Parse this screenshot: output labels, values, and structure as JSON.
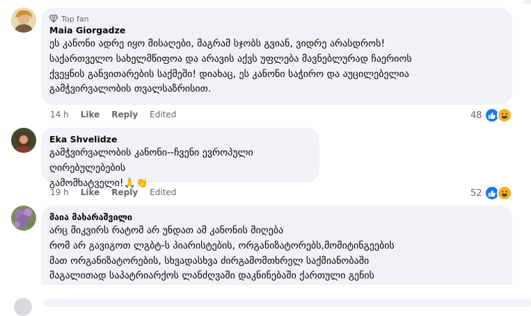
{
  "comments": [
    {
      "badge": "Top fan",
      "author": "Maia Giorgadze",
      "text": "ეს კანონი ადრე იყო მისაღები, მაგრამ სჯობს გვიან, ვიდრე არასდროს!\nსაქართველო სახელმწიფოა და არავის აქვს უფლება მავნებლურად ჩაერიოს\nქვეყნის განვითარების საქმეში! დიახაც, ეს კანონი საჭირო და აუცილებელია\nგამჭვირვალობის თვალსაზრისით.",
      "time": "14 h",
      "like": "Like",
      "reply": "Reply",
      "edited": "Edited",
      "reaction_count": "48"
    },
    {
      "author": "Eka Shvelidze",
      "text": "გამჭვირვალობის კანონი--ჩვენი ევროპული ღირებულებების\nგამომხატველი!🙏👏",
      "time": "19 h",
      "like": "Like",
      "reply": "Reply",
      "edited": "Edited",
      "reaction_count": "52"
    },
    {
      "author": "მაია მახარაშვილი",
      "text": "არც მიკვირს რატომ არ უნდათ ამ კანონის მიღება\nრომ არ გავიგოთ ლგბტ-ს პიარისტების, ორგანიზატორებს,მომიტინგეების\nმათ ორგანიზატორების, სხვადასხვა ძირგამომთხრელ საქმიანობაში\nმაგალითად საპატრიარქოს ლანძღვაში დაკნინებაში ქართული გენის"
    }
  ],
  "colors": {
    "bubble": "#f0f2f5",
    "meta_text": "#65676b",
    "like_blue": "#1877f2",
    "haha_yellow": "#f7b125"
  }
}
